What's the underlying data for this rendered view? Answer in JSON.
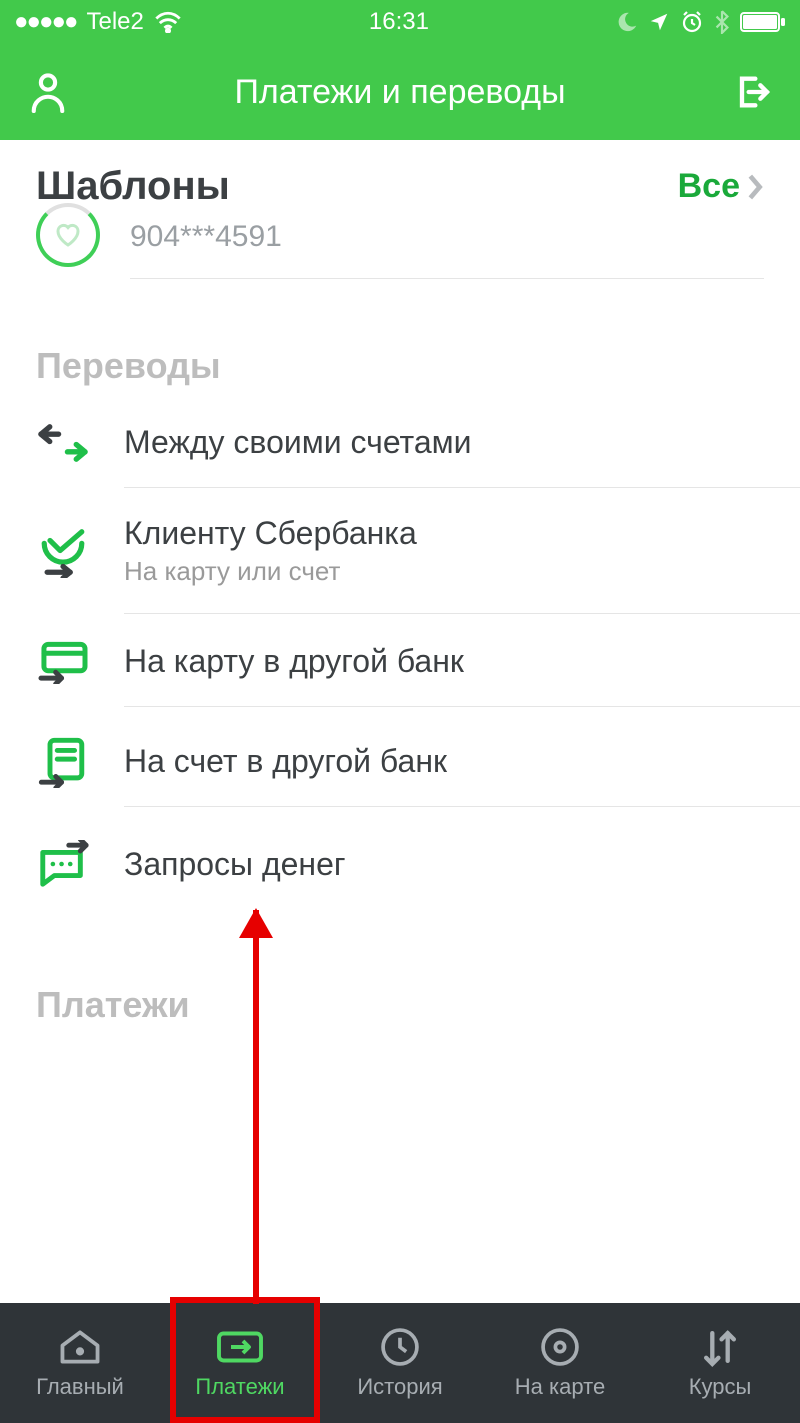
{
  "status": {
    "carrier": "Tele2",
    "time": "16:31"
  },
  "header": {
    "title": "Платежи и переводы"
  },
  "templates": {
    "title": "Шаблоны",
    "all_label": "Все",
    "item_number": "904***4591"
  },
  "transfers": {
    "section_label": "Переводы",
    "items": [
      {
        "title": "Между своими счетами",
        "sub": ""
      },
      {
        "title": "Клиенту Сбербанка",
        "sub": "На карту или счет"
      },
      {
        "title": "На карту в другой банк",
        "sub": ""
      },
      {
        "title": "На счет в другой банк",
        "sub": ""
      },
      {
        "title": "Запросы денег",
        "sub": ""
      }
    ]
  },
  "payments": {
    "section_label": "Платежи"
  },
  "tabs": [
    {
      "label": "Главный"
    },
    {
      "label": "Платежи"
    },
    {
      "label": "История"
    },
    {
      "label": "На карте"
    },
    {
      "label": "Курсы"
    }
  ]
}
